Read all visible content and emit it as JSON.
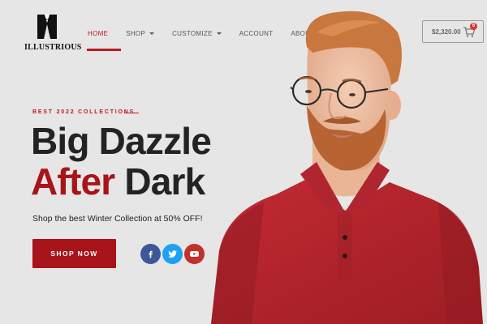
{
  "brand": {
    "name": "ILLUSTRIOUS"
  },
  "nav": {
    "items": [
      {
        "label": "HOME",
        "active": true
      },
      {
        "label": "SHOP",
        "dropdown": true
      },
      {
        "label": "CUSTOMIZE",
        "dropdown": true
      },
      {
        "label": "ACCOUNT"
      },
      {
        "label": "ABOUT"
      }
    ]
  },
  "cart": {
    "total": "$2,320.00",
    "count": "6",
    "icon": "shopping-cart-icon"
  },
  "hero": {
    "eyebrow": "BEST 2022 COLLECTIONS",
    "headline_line1": "Big Dazzle",
    "headline_accent": "After",
    "headline_rest": " Dark",
    "subtitle": "Shop the best Winter Collection at 50% OFF!",
    "cta_label": "SHOP NOW"
  },
  "social": [
    {
      "icon": "facebook-icon",
      "color": "#3b5998"
    },
    {
      "icon": "twitter-icon",
      "color": "#1da1f2"
    },
    {
      "icon": "youtube-icon",
      "color": "#c4302b"
    }
  ],
  "colors": {
    "accent": "#a8141a",
    "nav_active": "#c0191d",
    "background": "#e6e6e6",
    "shirt": "#b8242c"
  }
}
